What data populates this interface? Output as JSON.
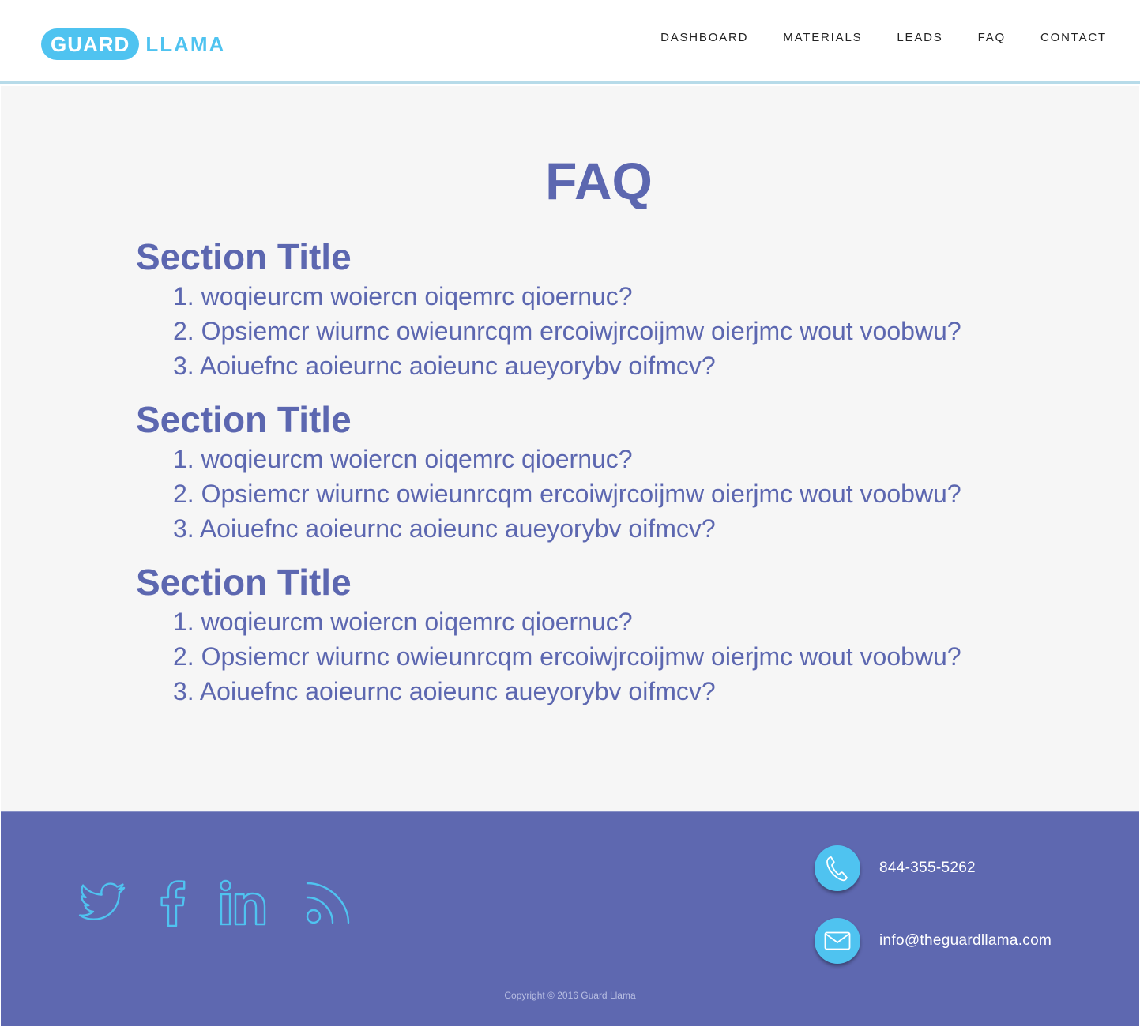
{
  "header": {
    "logo": {
      "primary": "GUARD",
      "secondary": "LLAMA"
    },
    "nav": [
      {
        "label": "DASHBOARD"
      },
      {
        "label": "MATERIALS"
      },
      {
        "label": "LEADS"
      },
      {
        "label": "FAQ"
      },
      {
        "label": "CONTACT"
      }
    ]
  },
  "main": {
    "title": "FAQ",
    "sections": [
      {
        "title": "Section Title",
        "questions": [
          "1. woqieurcm woiercn oiqemrc qioernuc?",
          "2. Opsiemcr wiurnc owieunrcqm ercoiwjrcoijmw oierjmc wout voobwu?",
          "3. Aoiuefnc aoieurnc aoieunc aueyorybv oifmcv?"
        ]
      },
      {
        "title": "Section Title",
        "questions": [
          "1. woqieurcm woiercn oiqemrc qioernuc?",
          "2. Opsiemcr wiurnc owieunrcqm ercoiwjrcoijmw oierjmc wout voobwu?",
          "3. Aoiuefnc aoieurnc aoieunc aueyorybv oifmcv?"
        ]
      },
      {
        "title": "Section Title",
        "questions": [
          "1. woqieurcm woiercn oiqemrc qioernuc?",
          "2. Opsiemcr wiurnc owieunrcqm ercoiwjrcoijmw oierjmc wout voobwu?",
          "3. Aoiuefnc aoieurnc aoieunc aueyorybv oifmcv?"
        ]
      }
    ]
  },
  "footer": {
    "social": [
      "twitter-icon",
      "facebook-icon",
      "linkedin-icon",
      "rss-icon"
    ],
    "phone": "844-355-5262",
    "email": "info@theguardllama.com",
    "copyright": "Copyright © 2016 Guard Llama"
  },
  "colors": {
    "accent": "#4fc3f0",
    "heading": "#5c67b0",
    "footer_bg": "#5e68b0",
    "header_rule": "#b7dbe9"
  }
}
